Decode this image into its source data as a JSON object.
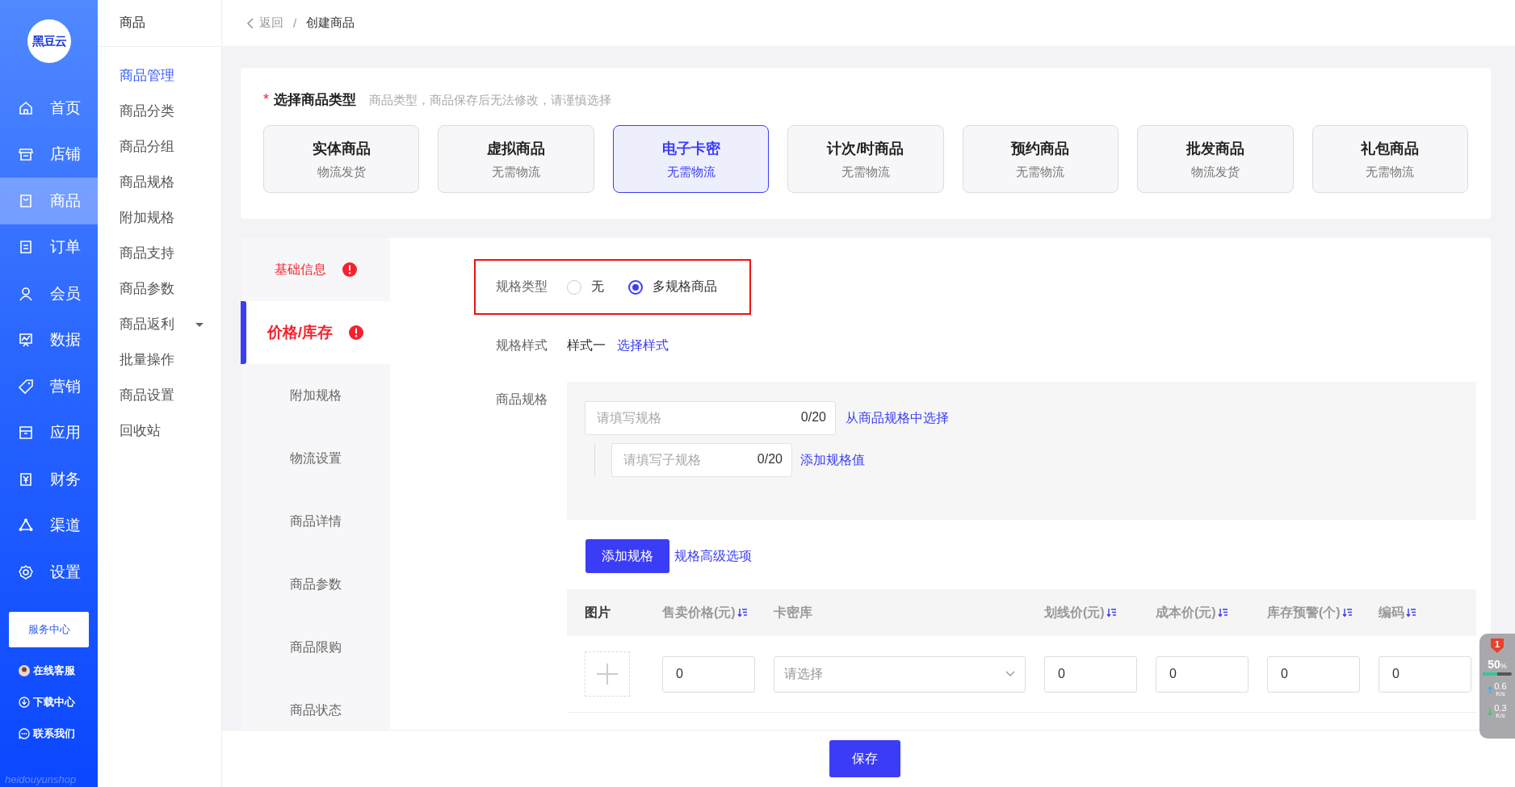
{
  "brand": {
    "logo": "黑豆云",
    "footer": "heidouyunshop"
  },
  "nav": [
    {
      "label": "首页",
      "selected": false
    },
    {
      "label": "店铺",
      "selected": false
    },
    {
      "label": "商品",
      "selected": true
    },
    {
      "label": "订单",
      "selected": false
    },
    {
      "label": "会员",
      "selected": false
    },
    {
      "label": "数据",
      "selected": false
    },
    {
      "label": "营销",
      "selected": false
    },
    {
      "label": "应用",
      "selected": false
    },
    {
      "label": "财务",
      "selected": false
    },
    {
      "label": "渠道",
      "selected": false
    },
    {
      "label": "设置",
      "selected": false
    }
  ],
  "service_button": "服务中心",
  "help_links": [
    {
      "label": "在线客服",
      "kind": "avatar"
    },
    {
      "label": "下载中心",
      "kind": "download"
    },
    {
      "label": "联系我们",
      "kind": "chat"
    }
  ],
  "submenu": {
    "title": "商品",
    "items": [
      {
        "label": "商品管理",
        "selected": true,
        "expandable": false
      },
      {
        "label": "商品分类",
        "selected": false,
        "expandable": false
      },
      {
        "label": "商品分组",
        "selected": false,
        "expandable": false
      },
      {
        "label": "商品规格",
        "selected": false,
        "expandable": false
      },
      {
        "label": "附加规格",
        "selected": false,
        "expandable": false
      },
      {
        "label": "商品支持",
        "selected": false,
        "expandable": false
      },
      {
        "label": "商品参数",
        "selected": false,
        "expandable": false
      },
      {
        "label": "商品返利",
        "selected": false,
        "expandable": true
      },
      {
        "label": "批量操作",
        "selected": false,
        "expandable": false
      },
      {
        "label": "商品设置",
        "selected": false,
        "expandable": false
      },
      {
        "label": "回收站",
        "selected": false,
        "expandable": false
      }
    ]
  },
  "breadcrumb": {
    "back": "返回",
    "separator": "/",
    "current": "创建商品"
  },
  "type_section": {
    "required": true,
    "required_mark": "*",
    "title": "选择商品类型",
    "hint": "商品类型，商品保存后无法修改，请谨慎选择",
    "types": [
      {
        "name": "实体商品",
        "shipping": "物流发货",
        "selected": false
      },
      {
        "name": "虚拟商品",
        "shipping": "无需物流",
        "selected": false
      },
      {
        "name": "电子卡密",
        "shipping": "无需物流",
        "selected": true
      },
      {
        "name": "计次/时商品",
        "shipping": "无需物流",
        "selected": false
      },
      {
        "name": "预约商品",
        "shipping": "无需物流",
        "selected": false
      },
      {
        "name": "批发商品",
        "shipping": "物流发货",
        "selected": false
      },
      {
        "name": "礼包商品",
        "shipping": "无需物流",
        "selected": false
      }
    ]
  },
  "form_tabs": [
    {
      "label": "基础信息",
      "selected": false,
      "error": true
    },
    {
      "label": "价格/库存",
      "selected": true,
      "error": true
    },
    {
      "label": "附加规格",
      "selected": false,
      "error": false
    },
    {
      "label": "物流设置",
      "selected": false,
      "error": false
    },
    {
      "label": "商品详情",
      "selected": false,
      "error": false
    },
    {
      "label": "商品参数",
      "selected": false,
      "error": false
    },
    {
      "label": "商品限购",
      "selected": false,
      "error": false
    },
    {
      "label": "商品状态",
      "selected": false,
      "error": false
    }
  ],
  "spec_type": {
    "label": "规格类型",
    "highlighted": true,
    "options": [
      {
        "label": "无",
        "selected": false
      },
      {
        "label": "多规格商品",
        "selected": true
      }
    ]
  },
  "spec_style": {
    "label": "规格样式",
    "value": "样式一",
    "link": "选择样式"
  },
  "spec": {
    "label": "商品规格",
    "name_field": {
      "placeholder": "请填写规格",
      "counter": "0/20"
    },
    "name_link": "从商品规格中选择",
    "value_field": {
      "placeholder": "请填写子规格",
      "counter": "0/20"
    },
    "value_link": "添加规格值"
  },
  "add_spec_button": "添加规格",
  "advanced_link": "规格高级选项",
  "table": {
    "columns": [
      {
        "label": "图片",
        "sortable": false,
        "emphasis": true
      },
      {
        "label": "售卖价格(元)",
        "sortable": true,
        "emphasis": false
      },
      {
        "label": "卡密库",
        "sortable": false,
        "emphasis": false
      },
      {
        "label": "划线价(元)",
        "sortable": true,
        "emphasis": false
      },
      {
        "label": "成本价(元)",
        "sortable": true,
        "emphasis": false
      },
      {
        "label": "库存预警(个)",
        "sortable": true,
        "emphasis": false
      },
      {
        "label": "编码",
        "sortable": true,
        "emphasis": false
      }
    ],
    "rows": [
      {
        "cells": [
          {
            "kind": "image"
          },
          {
            "kind": "input",
            "value": "0"
          },
          {
            "kind": "select",
            "placeholder": "请选择"
          },
          {
            "kind": "input",
            "value": "0"
          },
          {
            "kind": "input",
            "value": "0"
          },
          {
            "kind": "input",
            "value": "0"
          },
          {
            "kind": "input",
            "value": "0"
          }
        ]
      }
    ]
  },
  "save_button": "保存",
  "speed_widget": {
    "badge": "1",
    "percent": "50",
    "percent_unit": "%",
    "level": 0.5,
    "upload": "0.6",
    "upload_unit": "K/s",
    "download": "0.3",
    "download_unit": "K/s"
  }
}
